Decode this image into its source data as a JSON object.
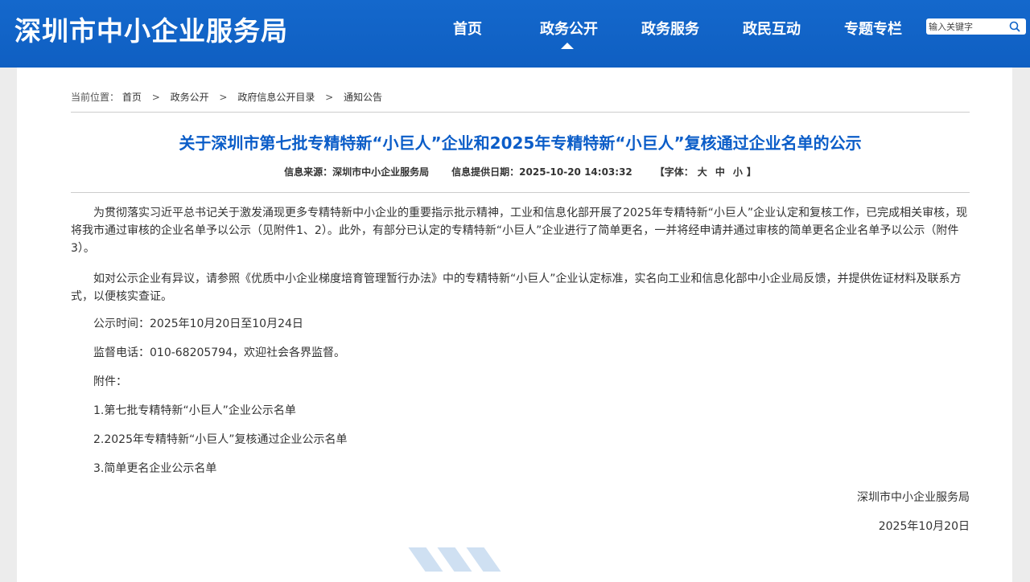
{
  "site": {
    "title": "深圳市中小企业服务局"
  },
  "nav": {
    "items": [
      {
        "label": "首页"
      },
      {
        "label": "政务公开"
      },
      {
        "label": "政务服务"
      },
      {
        "label": "政民互动"
      },
      {
        "label": "专题专栏"
      }
    ],
    "active": "政务公开"
  },
  "search": {
    "placeholder": "输入关键字"
  },
  "breadcrumb": {
    "prefix": "当前位置：",
    "items": [
      "首页",
      "政务公开",
      "政府信息公开目录",
      "通知公告"
    ],
    "separator": ">"
  },
  "article": {
    "title": "关于深圳市第七批专精特新“小巨人”企业和2025年专精特新“小巨人”复核通过企业名单的公示",
    "source_label": "信息来源：深圳市中小企业服务局",
    "date_label": "信息提供日期：2025-10-20 14:03:32",
    "font_size": {
      "open": "【字体：",
      "large": "大",
      "medium": "中",
      "small": "小",
      "close": "】"
    },
    "paragraph1": "为贯彻落实习近平总书记关于激发涌现更多专精特新中小企业的重要指示批示精神，工业和信息化部开展了2025年专精特新“小巨人”企业认定和复核工作，已完成相关审核，现将我市通过审核的企业名单予以公示（见附件1、2）。此外，有部分已认定的专精特新“小巨人”企业进行了简单更名，一并将经申请并通过审核的简单更名企业名单予以公示（附件3）。",
    "paragraph2": "如对公示企业有异议，请参照《优质中小企业梯度培育管理暂行办法》中的专精特新“小巨人”企业认定标准，实名向工业和信息化部中小企业局反馈，并提供佐证材料及联系方式，以便核实查证。",
    "period": "公示时间：2025年10月20日至10月24日",
    "phone": "监督电话：010-68205794，欢迎社会各界监督。",
    "attachments_label": "附件：",
    "attachments": [
      "1.第七批专精特新“小巨人”企业公示名单",
      "2.2025年专精特新“小巨人”复核通过企业公示名单",
      "3.简单更名企业公示名单"
    ],
    "signature": "深圳市中小企业服务局",
    "sign_date": "2025年10月20日"
  },
  "colors": {
    "header_bg": "#1164c8",
    "title": "#0b5dc8",
    "page_bg": "#ececec"
  },
  "icons": {
    "search": "search-icon",
    "nav_caret": "caret-up-icon"
  }
}
